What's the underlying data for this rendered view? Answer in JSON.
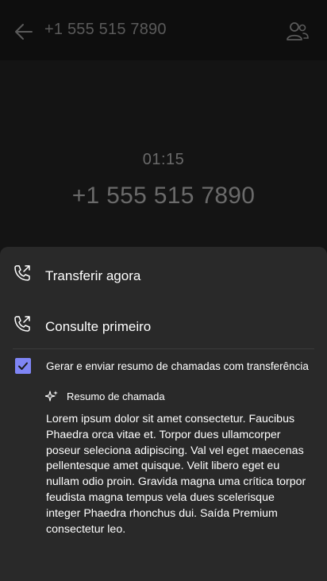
{
  "header": {
    "title": "+1 555 515 7890"
  },
  "call": {
    "timer": "01:15",
    "number": "+1 555 515 7890"
  },
  "sheet": {
    "options": [
      {
        "label": "Transferir agora"
      },
      {
        "label": "Consulte primeiro"
      }
    ],
    "checkbox_label": "Gerar e enviar resumo de chamadas com transferência",
    "checkbox_checked": true,
    "summary_title": "Resumo de chamada",
    "summary_text": "Lorem ipsum dolor sit amet consectetur. Faucibus Phaedra orca vitae et. Torpor dues ullamcorper poseur seleciona adipiscing. Val vel eget maecenas pellentesque amet quisque. Velit libero eget eu nullam odio proin. Gravida magna uma crítica torpor feudista magna tempus vela dues scelerisque integer Phaedra rhonchus dui. Saída Premium consectetur leo."
  },
  "colors": {
    "accent": "#7f85f5",
    "sheet_bg": "#292929",
    "muted_text": "#6a6a6a"
  }
}
